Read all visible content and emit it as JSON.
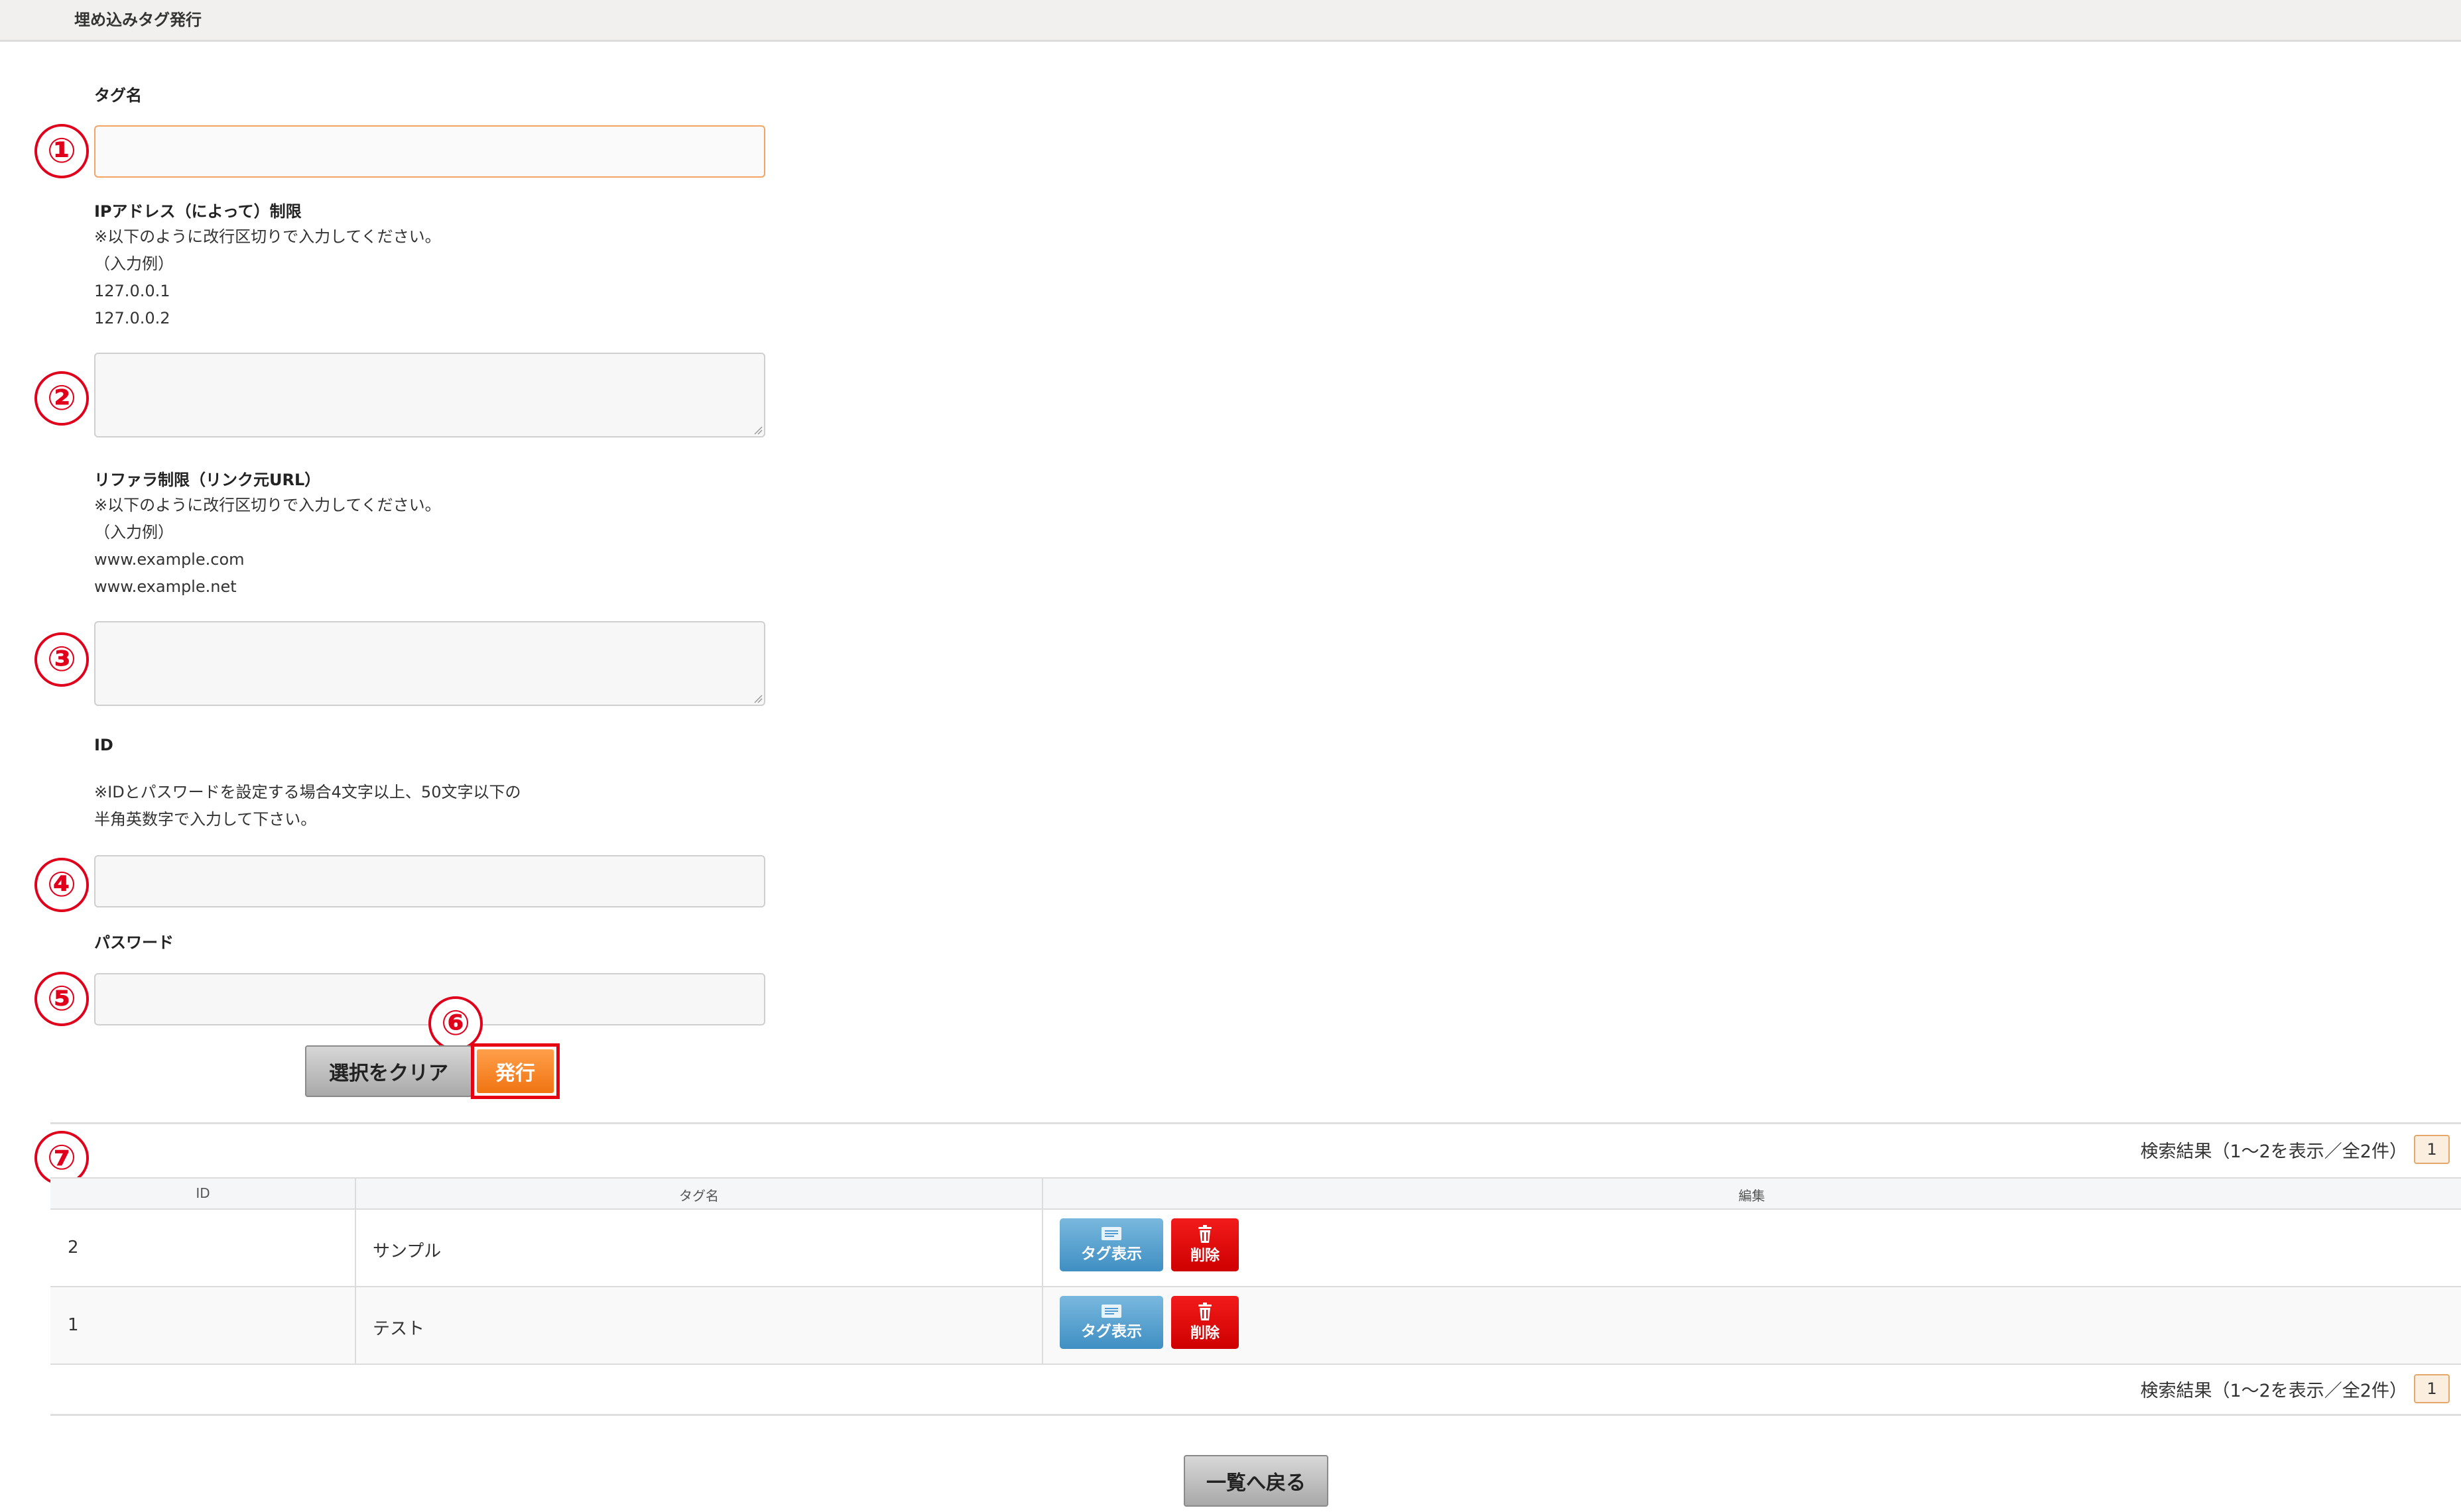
{
  "header": {
    "title": "埋め込みタグ発行"
  },
  "form": {
    "tag_name_label": "タグ名",
    "tag_name_value": "",
    "ip_label": "IPアドレス（によって）制限",
    "ip_note": "※以下のように改行区切りで入力してください。",
    "ip_example_label": "（入力例）",
    "ip_example_1": "127.0.0.1",
    "ip_example_2": "127.0.0.2",
    "ip_value": "",
    "referrer_label": "リファラ制限（リンク元URL）",
    "referrer_note": "※以下のように改行区切りで入力してください。",
    "referrer_example_label": "（入力例）",
    "referrer_example_1": "www.example.com",
    "referrer_example_2": "www.example.net",
    "referrer_value": "",
    "id_label": "ID",
    "id_note_1": "※IDとパスワードを設定する場合4文字以上、50文字以下の",
    "id_note_2": "半角英数字で入力して下さい。",
    "id_value": "",
    "password_label": "パスワード",
    "password_value": ""
  },
  "buttons": {
    "clear": "選択をクリア",
    "issue": "発行",
    "back": "一覧へ戻る"
  },
  "markers": [
    "①",
    "②",
    "③",
    "④",
    "⑤",
    "⑥",
    "⑦"
  ],
  "results": {
    "summary": "検索結果（1〜2を表示／全2件）",
    "page": "1",
    "columns": [
      "ID",
      "タグ名",
      "編集"
    ],
    "rows": [
      {
        "id": "2",
        "name": "サンプル",
        "show_label": "タグ表示",
        "delete_label": "削除"
      },
      {
        "id": "1",
        "name": "テスト",
        "show_label": "タグ表示",
        "delete_label": "削除"
      }
    ]
  },
  "colors": {
    "marker_red": "#e0001b",
    "issue_orange": "#f07412",
    "delete_red": "#e00000",
    "show_blue": "#4d9bcf"
  }
}
